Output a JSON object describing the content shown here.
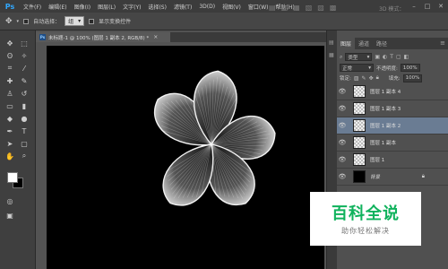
{
  "app": {
    "logo": "Ps",
    "accent": "#31a8ff"
  },
  "menubar": {
    "items": [
      "文件(F)",
      "编辑(E)",
      "图像(I)",
      "图层(L)",
      "文字(Y)",
      "选择(S)",
      "滤镜(T)",
      "3D(D)",
      "视图(V)",
      "窗口(W)",
      "帮助(H)"
    ],
    "window_controls": [
      "minimize-icon",
      "maximize-icon",
      "close-icon"
    ]
  },
  "options_bar": {
    "auto_select_label": "自动选择：",
    "auto_select_value": "组",
    "show_transform_label": "显示变换控件",
    "mode_3d_label": "3D 模式："
  },
  "document": {
    "tab_title": "未标题-1 @ 100% (图层 1 副本 2, RGB/8) *",
    "close_glyph": "×",
    "canvas_bg": "#000000"
  },
  "toolbox": {
    "foreground_color": "#ffffff",
    "background_color": "#000000"
  },
  "layers_panel": {
    "tabs": [
      "图层",
      "通道",
      "路径"
    ],
    "active_tab": "图层",
    "filter_kind": "类型",
    "blend_mode": "正常",
    "opacity_label": "不透明度:",
    "opacity_value": "100%",
    "lock_label": "锁定:",
    "fill_label": "填充:",
    "fill_value": "100%",
    "layers": [
      {
        "name": "图层 1 副本 4",
        "selected": false,
        "thumb": "transparent"
      },
      {
        "name": "图层 1 副本 3",
        "selected": false,
        "thumb": "transparent"
      },
      {
        "name": "图层 1 副本 2",
        "selected": true,
        "thumb": "transparent"
      },
      {
        "name": "图层 1 副本",
        "selected": false,
        "thumb": "transparent"
      },
      {
        "name": "图层 1",
        "selected": false,
        "thumb": "transparent"
      },
      {
        "name": "背景",
        "selected": false,
        "thumb": "black",
        "locked": true
      }
    ]
  },
  "watermark": {
    "title": "百科全说",
    "subtitle": "助你轻松解决",
    "color": "#0fb25c"
  }
}
